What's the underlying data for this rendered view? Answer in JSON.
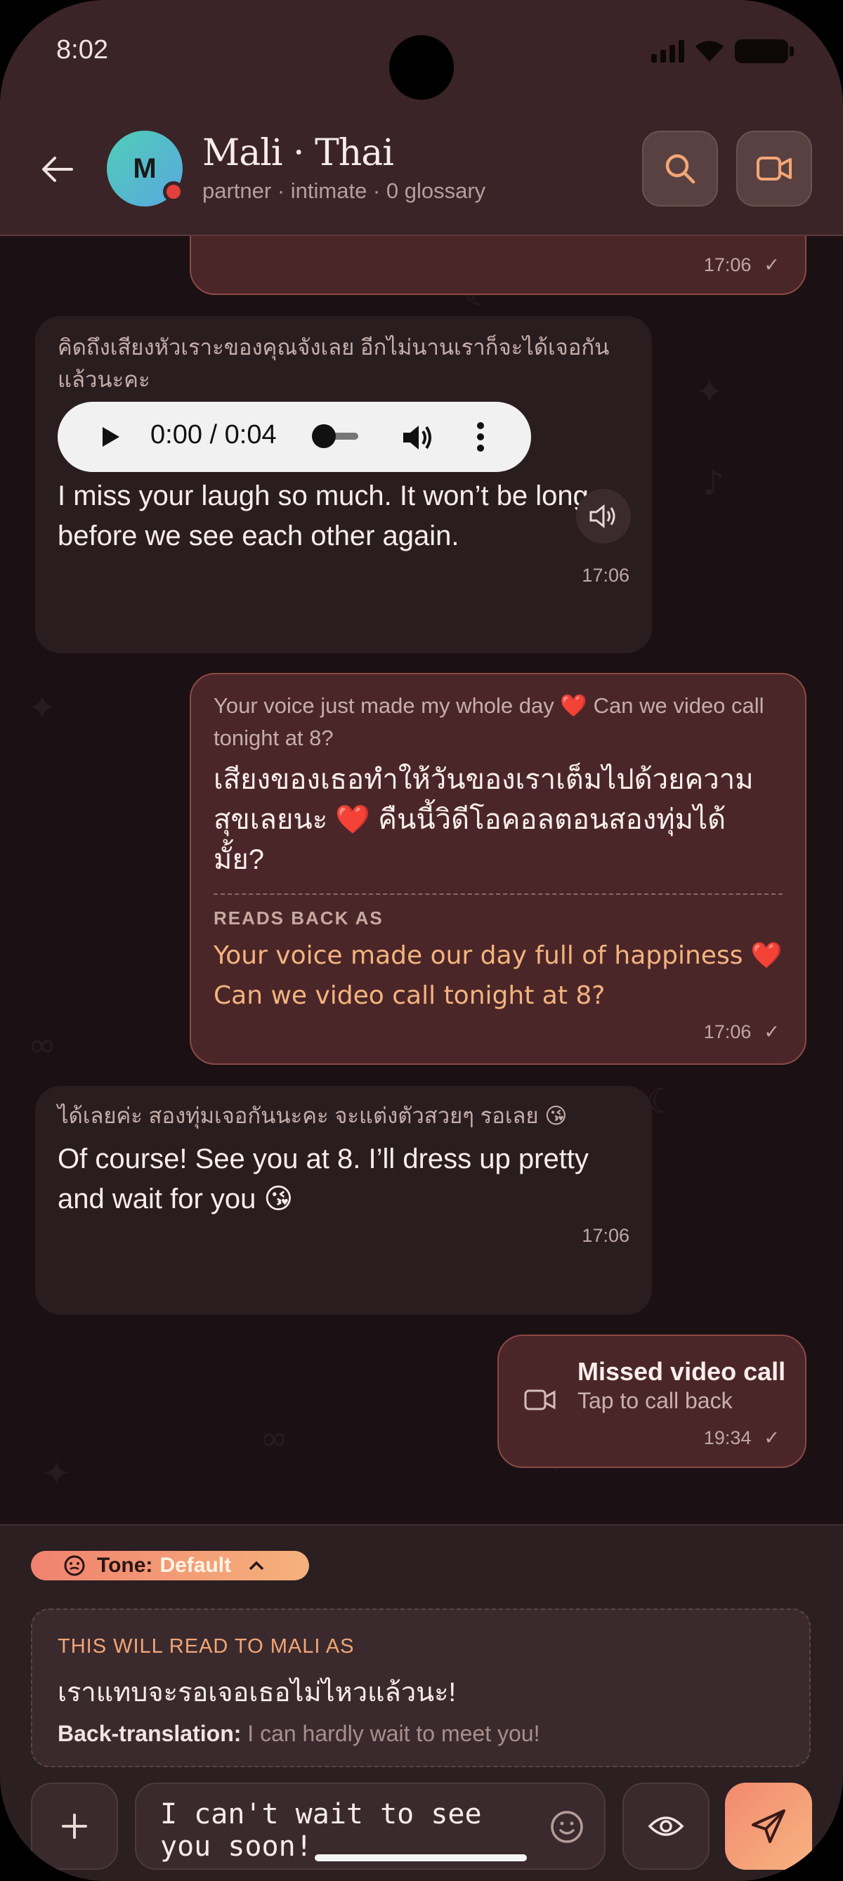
{
  "status_bar": {
    "time": "8:02"
  },
  "header": {
    "avatar_initial": "M",
    "name": "Mali · Thai",
    "subtitle": "partner · intimate · 0 glossary"
  },
  "messages": [
    {
      "direction": "out",
      "time": "17:06",
      "status": "sent"
    },
    {
      "direction": "in",
      "original": "คิดถึงเสียงหัวเราะของคุณจังเลย อีกไม่นานเราก็จะได้เจอกันแล้วนะคะ",
      "audio": {
        "time_display": "0:00 / 0:04"
      },
      "translation": "I miss your laugh so much. It won’t be long before we see each other again.",
      "time": "17:06"
    },
    {
      "direction": "out",
      "original": "Your voice just made my whole day ❤️ Can we video call tonight at 8?",
      "translation": "เสียงของเธอทำให้วันของเราเต็มไปด้วยความสุขเลยนะ ❤️ คืนนี้วิดีโอคอลตอนสองทุ่มได้มั้ย?",
      "readback_label": "READS BACK AS",
      "readback": "Your voice made our day full of happiness ❤️ Can we video call tonight at 8?",
      "time": "17:06",
      "status": "sent"
    },
    {
      "direction": "in",
      "original": "ได้เลยค่ะ สองทุ่มเจอกันนะคะ จะแต่งตัวสวยๆ รอเลย 😘",
      "translation": "Of course! See you at 8. I’ll dress up pretty and wait for you 😘",
      "time": "17:06"
    },
    {
      "direction": "out",
      "type": "missed_call",
      "title": "Missed video call",
      "subtitle": "Tap to call back",
      "time": "19:34",
      "status": "sent"
    }
  ],
  "composer": {
    "tone_label": "Tone:",
    "tone_value": "Default",
    "preview_label": "THIS WILL READ TO MALI AS",
    "preview_text": "เราแทบจะรอเจอเธอไม่ไหวแล้วนะ!",
    "back_translation_label": "Back-translation:",
    "back_translation_text": "I can hardly wait to meet you!",
    "input_value": "I can't wait to see you soon!"
  },
  "colors": {
    "background": "#1b1014",
    "header": "#3a2427",
    "incoming_bubble": "#2a1d20",
    "outgoing_bubble": "#4b2628",
    "accent_orange": "#f5b27c",
    "readback_text": "#f3b47f"
  }
}
